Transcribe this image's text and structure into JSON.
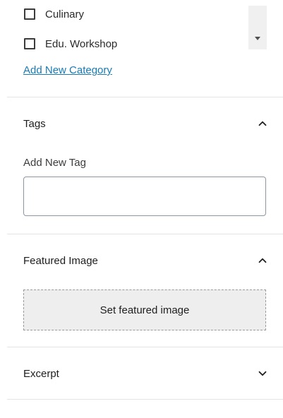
{
  "categories": {
    "items": [
      {
        "label": "Culinary",
        "checked": false
      },
      {
        "label": "Edu. Workshop",
        "checked": false
      }
    ],
    "add_new_label": "Add New Category"
  },
  "tags": {
    "title": "Tags",
    "expanded": true,
    "input_label": "Add New Tag",
    "input_value": ""
  },
  "featured_image": {
    "title": "Featured Image",
    "expanded": true,
    "button_label": "Set featured image"
  },
  "excerpt": {
    "title": "Excerpt",
    "expanded": false
  },
  "icons": {
    "collapse": "chevron-up-icon",
    "expand": "chevron-down-icon",
    "scroll": "scroll-down-arrow-icon"
  },
  "colors": {
    "link": "#1a7ab5",
    "divider": "#e2e4e7",
    "featured_bg": "#eeeeee"
  }
}
